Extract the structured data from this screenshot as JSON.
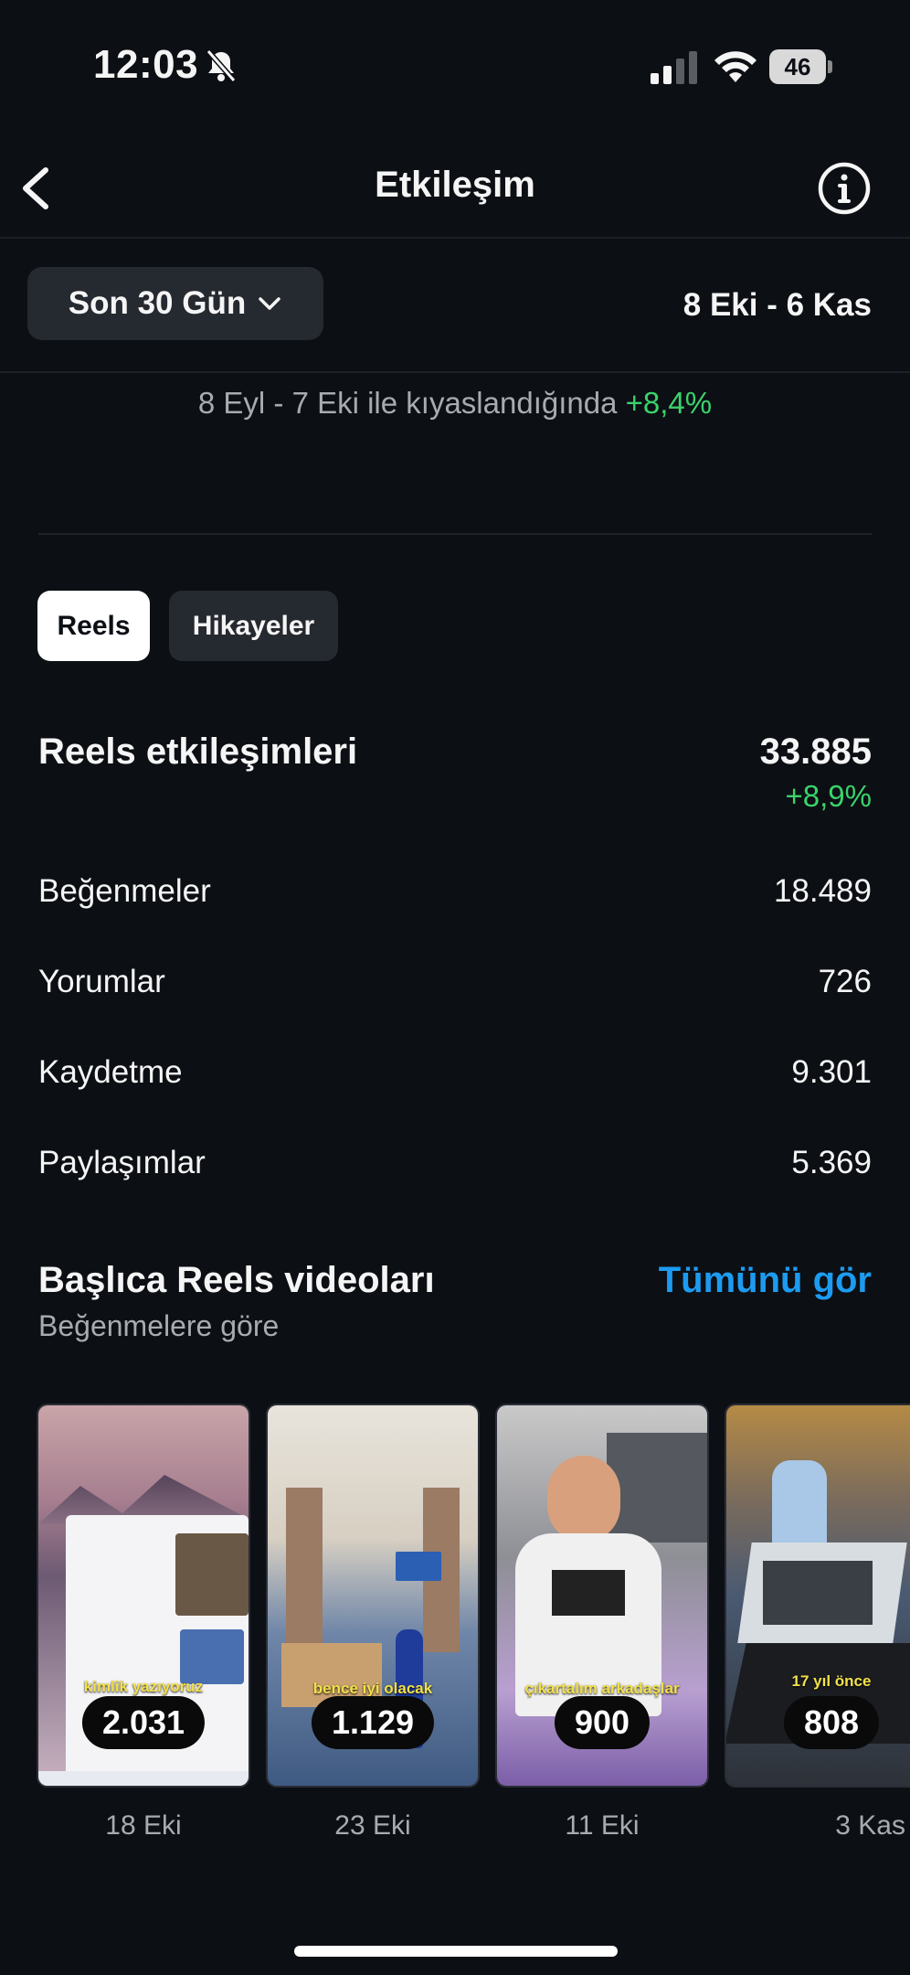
{
  "status": {
    "time": "12:03",
    "battery": "46"
  },
  "header": {
    "title": "Etkileşim"
  },
  "period": {
    "selector_label": "Son 30 Gün",
    "date_range": "8 Eki - 6 Kas"
  },
  "comparison": {
    "text": "8 Eyl - 7 Eki ile kıyaslandığında",
    "change": "+8,4%"
  },
  "tabs": [
    {
      "label": "Reels",
      "active": true
    },
    {
      "label": "Hikayeler",
      "active": false
    }
  ],
  "summary": {
    "label": "Reels etkileşimleri",
    "value": "33.885",
    "change": "+8,9%"
  },
  "metrics": [
    {
      "label": "Beğenmeler",
      "value": "18.489"
    },
    {
      "label": "Yorumlar",
      "value": "726"
    },
    {
      "label": "Kaydetme",
      "value": "9.301"
    },
    {
      "label": "Paylaşımlar",
      "value": "5.369"
    }
  ],
  "top_reels": {
    "title": "Başlıca Reels videoları",
    "subtitle": "Beğenmelere göre",
    "see_all": "Tümünü gör",
    "items": [
      {
        "count": "2.031",
        "date": "18 Eki",
        "caption": "kimlik yazıyoruz"
      },
      {
        "count": "1.129",
        "date": "23 Eki",
        "caption": "bence iyi olacak"
      },
      {
        "count": "900",
        "date": "11 Eki",
        "caption": "çıkartalım arkadaşlar"
      },
      {
        "count": "808",
        "date": "3 Kas",
        "caption": "17 yıl önce"
      }
    ]
  },
  "colors": {
    "background": "#0c0f14",
    "positive": "#3bd26b",
    "link": "#1d9bf0",
    "chip": "#252930"
  }
}
